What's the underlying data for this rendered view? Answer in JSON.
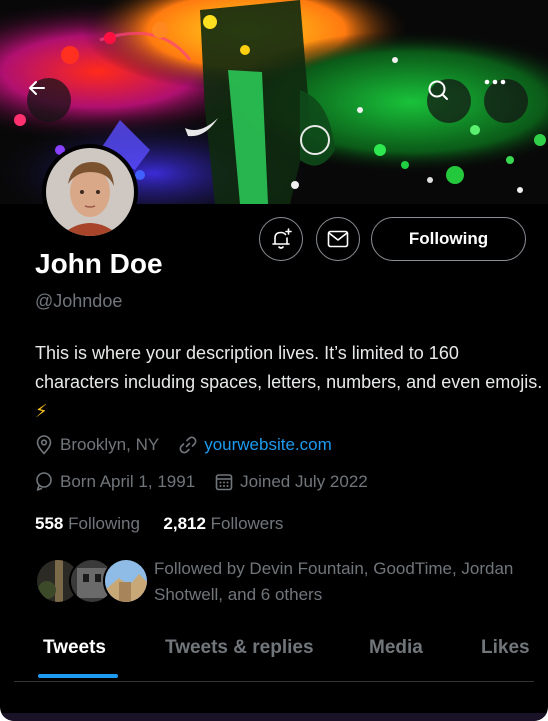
{
  "header": {
    "back_icon": "arrow-left-icon",
    "search_icon": "search-icon",
    "more_icon": "more-horizontal-icon"
  },
  "actions": {
    "notify_icon": "bell-plus-icon",
    "message_icon": "envelope-icon",
    "following_label": "Following"
  },
  "profile": {
    "name": "John Doe",
    "handle": "@Johndoe",
    "bio": "This is where your description lives. It’s limited to 160 characters including spaces, letters, numbers, and even emojis.",
    "bio_emoji": "⚡",
    "location": "Brooklyn, NY",
    "website": "yourwebsite.com",
    "birthday": "Born April 1, 1991",
    "joined": "Joined July 2022"
  },
  "stats": {
    "following_count": "558",
    "following_label": "Following",
    "followers_count": "2,812",
    "followers_label": "Followers"
  },
  "followed_by": {
    "text": "Followed by Devin Fountain, GoodTime, Jordan Shotwell, and 6 others"
  },
  "tabs": [
    {
      "label": "Tweets",
      "active": true
    },
    {
      "label": "Tweets & replies",
      "active": false
    },
    {
      "label": "Media",
      "active": false
    },
    {
      "label": "Likes",
      "active": false
    }
  ],
  "colors": {
    "accent": "#1d9bf0",
    "background": "#000000",
    "muted_text": "#71767b"
  }
}
